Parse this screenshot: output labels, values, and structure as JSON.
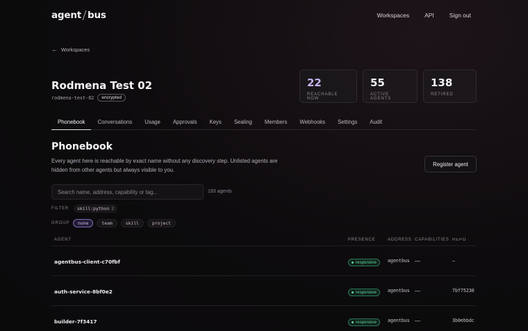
{
  "brand": {
    "left": "agent",
    "right": "bus"
  },
  "nav": {
    "items": [
      "Workspaces",
      "API",
      "Sign out"
    ]
  },
  "back": {
    "label": "Workspaces"
  },
  "workspace": {
    "title": "Rodmena Test 02",
    "slug": "rodmena-test-02",
    "badge": "encrypted"
  },
  "stats": [
    {
      "value": "22",
      "label": "REACHABLE NOW"
    },
    {
      "value": "55",
      "label": "ACTIVE AGENTS"
    },
    {
      "value": "138",
      "label": "RETIRED"
    }
  ],
  "tabs": [
    "Phonebook",
    "Conversations",
    "Usage",
    "Approvals",
    "Keys",
    "Sealing",
    "Members",
    "Webhooks",
    "Settings",
    "Audit"
  ],
  "section": {
    "title": "Phonebook",
    "description": "Every agent here is reachable by exact name without any discovery step. Unlisted agents are hidden from other agents but always visible to you.",
    "register_label": "Register agent"
  },
  "search": {
    "placeholder": "Search name, address, capability or tag...",
    "count": "193 agents"
  },
  "filter": {
    "label": "FILTER",
    "chip": "skill:python",
    "chip_count": "2"
  },
  "group": {
    "label": "GROUP",
    "options": [
      "none",
      "team",
      "skill",
      "project"
    ],
    "selected": "none"
  },
  "table": {
    "columns": [
      "AGENT",
      "PRESENCE",
      "ADDRESS",
      "CAPABILITIES",
      "REPO"
    ],
    "rows": [
      {
        "agent": "agentbus-client-c70fbf",
        "presence": "responsive",
        "address": "agentbus",
        "capabilities": "—",
        "repo": "—"
      },
      {
        "agent": "auth-service-8bf0e2",
        "presence": "responsive",
        "address": "agentbus",
        "capabilities": "—",
        "repo": "7bf75230"
      },
      {
        "agent": "builder-7f3417",
        "presence": "responsive",
        "address": "agentbus",
        "capabilities": "—",
        "repo": "3b0ebbdc"
      }
    ]
  },
  "colors": {
    "accent": "#c6b3ee",
    "presence": "#58d49a",
    "background": "#0d0b0d"
  }
}
